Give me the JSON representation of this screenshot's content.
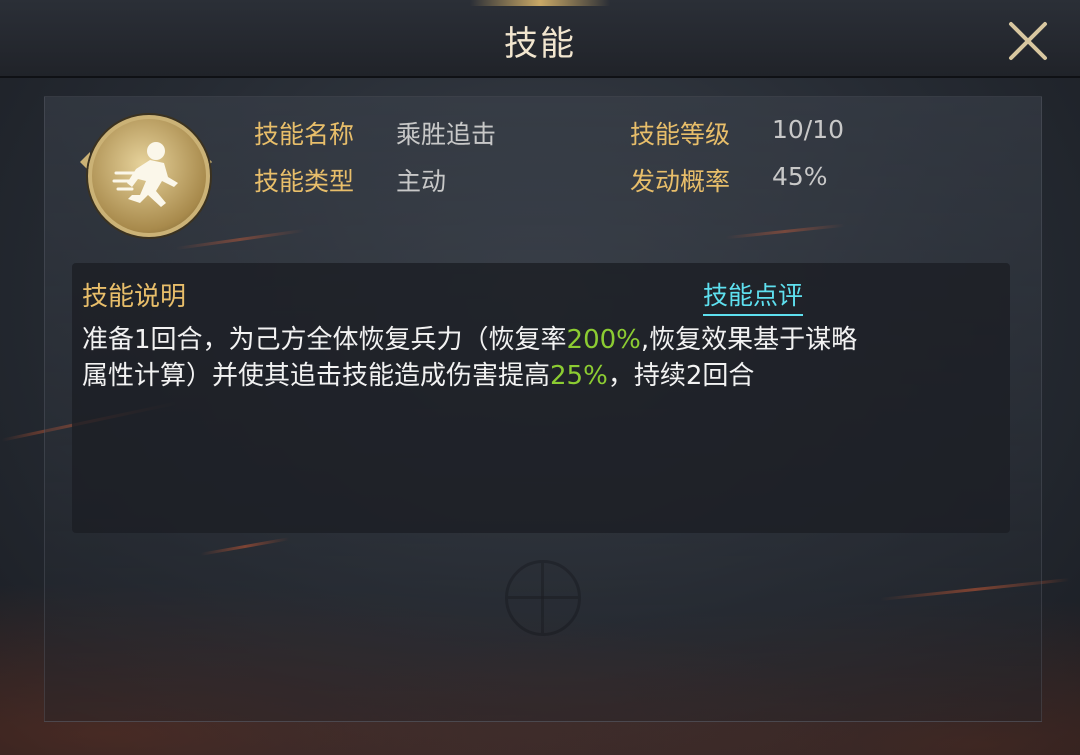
{
  "window": {
    "title": "技能"
  },
  "skill_info": {
    "name_label": "技能名称",
    "name_value": "乘胜追击",
    "type_label": "技能类型",
    "type_value": "主动",
    "level_label": "技能等级",
    "level_value": "10/10",
    "chance_label": "发动概率",
    "chance_value": "45%"
  },
  "description": {
    "title": "技能说明",
    "review_link": "技能点评",
    "line1_a": "准备1回合，为己方全体恢复兵力（恢复率",
    "line1_hl": "200%",
    "line1_b": ",恢复效果基于谋略",
    "line2_a": "属性计算）并使其追击技能造成伤害提高",
    "line2_hl": "25%",
    "line2_b": "，持续2回合"
  },
  "colors": {
    "label_gold": "#e8be6a",
    "value_grey": "#c8c8c8",
    "highlight_green": "#8ccc32",
    "link_cyan": "#5ee0ef"
  },
  "icons": [
    "close-icon",
    "skill-runner-icon"
  ]
}
